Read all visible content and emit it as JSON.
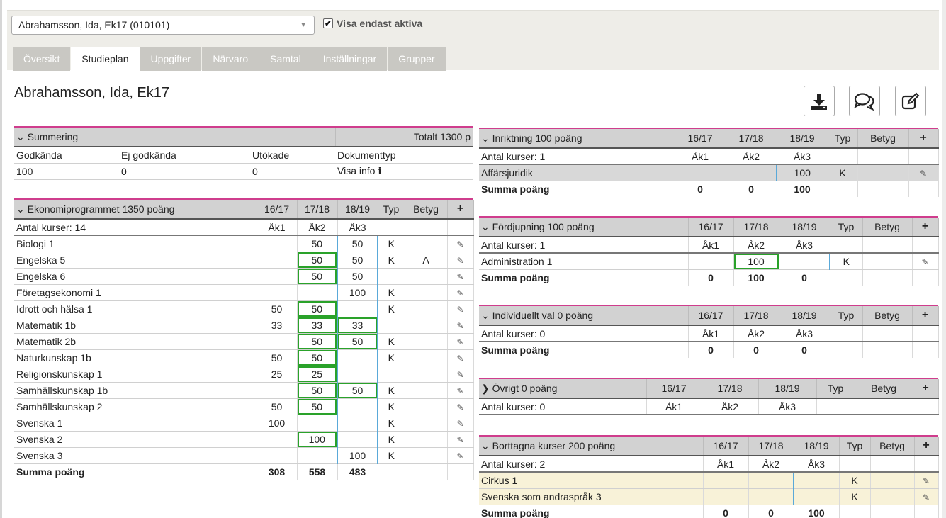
{
  "header": {
    "student_select": "Abrahamsson, Ida, Ek17 (010101)",
    "only_active_label": "Visa endast aktiva",
    "page_title": "Abrahamsson, Ida, Ek17"
  },
  "tabs": [
    "Översikt",
    "Studieplan",
    "Uppgifter",
    "Närvaro",
    "Samtal",
    "Inställningar",
    "Grupper"
  ],
  "icons": {
    "download": "download-icon",
    "comments": "comments-icon",
    "edit": "edit-icon",
    "row_edit": "edit-icon",
    "add": "plus-icon",
    "collapse": "chevron-down-icon",
    "expand": "chevron-right-icon",
    "info": "info-icon"
  },
  "summary": {
    "title": "Summering",
    "total": "Totalt 1300 p",
    "headers": [
      "Godkända",
      "Ej godkända",
      "Utökade",
      "Dokumenttyp"
    ],
    "values": [
      "100",
      "0",
      "0"
    ],
    "info_link": "Visa info"
  },
  "year_headers": [
    "16/17",
    "17/18",
    "18/19",
    "Typ",
    "Betyg"
  ],
  "course_years": [
    "Åk1",
    "Åk2",
    "Åk3"
  ],
  "sum_label": "Summa poäng",
  "program": {
    "title": "Ekonomiprogrammet 1350 poäng",
    "count": "Antal kurser: 14",
    "rows": [
      [
        "Biologi 1",
        "",
        "50",
        "50",
        "K",
        ""
      ],
      [
        "Engelska 5",
        "",
        "50",
        "50",
        "K",
        "A"
      ],
      [
        "Engelska 6",
        "",
        "50",
        "50",
        "",
        ""
      ],
      [
        "Företagsekonomi 1",
        "",
        "",
        "100",
        "K",
        ""
      ],
      [
        "Idrott och hälsa 1",
        "50",
        "50",
        "",
        "K",
        ""
      ],
      [
        "Matematik 1b",
        "33",
        "33",
        "33",
        "",
        ""
      ],
      [
        "Matematik 2b",
        "",
        "50",
        "50",
        "K",
        ""
      ],
      [
        "Naturkunskap 1b",
        "50",
        "50",
        "",
        "K",
        ""
      ],
      [
        "Religionskunskap 1",
        "25",
        "25",
        "",
        "",
        ""
      ],
      [
        "Samhällskunskap 1b",
        "",
        "50",
        "50",
        "K",
        ""
      ],
      [
        "Samhällskunskap 2",
        "50",
        "50",
        "",
        "K",
        ""
      ],
      [
        "Svenska 1",
        "100",
        "",
        "",
        "K",
        ""
      ],
      [
        "Svenska 2",
        "",
        "100",
        "",
        "K",
        ""
      ],
      [
        "Svenska 3",
        "",
        "",
        "100",
        "K",
        ""
      ]
    ],
    "sums": [
      "308",
      "558",
      "483"
    ]
  },
  "inriktning": {
    "title": "Inriktning 100 poäng",
    "count": "Antal kurser: 1",
    "rows": [
      [
        "Affärsjuridik",
        "",
        "",
        "100",
        "K",
        ""
      ]
    ],
    "sums": [
      "0",
      "0",
      "100"
    ]
  },
  "fordjupning": {
    "title": "Fördjupning 100 poäng",
    "count": "Antal kurser: 1",
    "rows": [
      [
        "Administration 1",
        "",
        "100",
        "",
        "K",
        ""
      ]
    ],
    "sums": [
      "0",
      "100",
      "0"
    ]
  },
  "individuellt": {
    "title": "Individuellt val 0 poäng",
    "count": "Antal kurser: 0",
    "sums": [
      "0",
      "0",
      "0"
    ]
  },
  "ovrigt": {
    "title": "Övrigt 0 poäng",
    "count": "Antal kurser: 0"
  },
  "borttagna": {
    "title": "Borttagna kurser 200 poäng",
    "count": "Antal kurser: 2",
    "rows": [
      [
        "Cirkus 1",
        "",
        "",
        "",
        "K",
        ""
      ],
      [
        "Svenska som andraspråk 3",
        "",
        "",
        "",
        "K",
        ""
      ]
    ],
    "sums": [
      "0",
      "0",
      "100"
    ]
  }
}
